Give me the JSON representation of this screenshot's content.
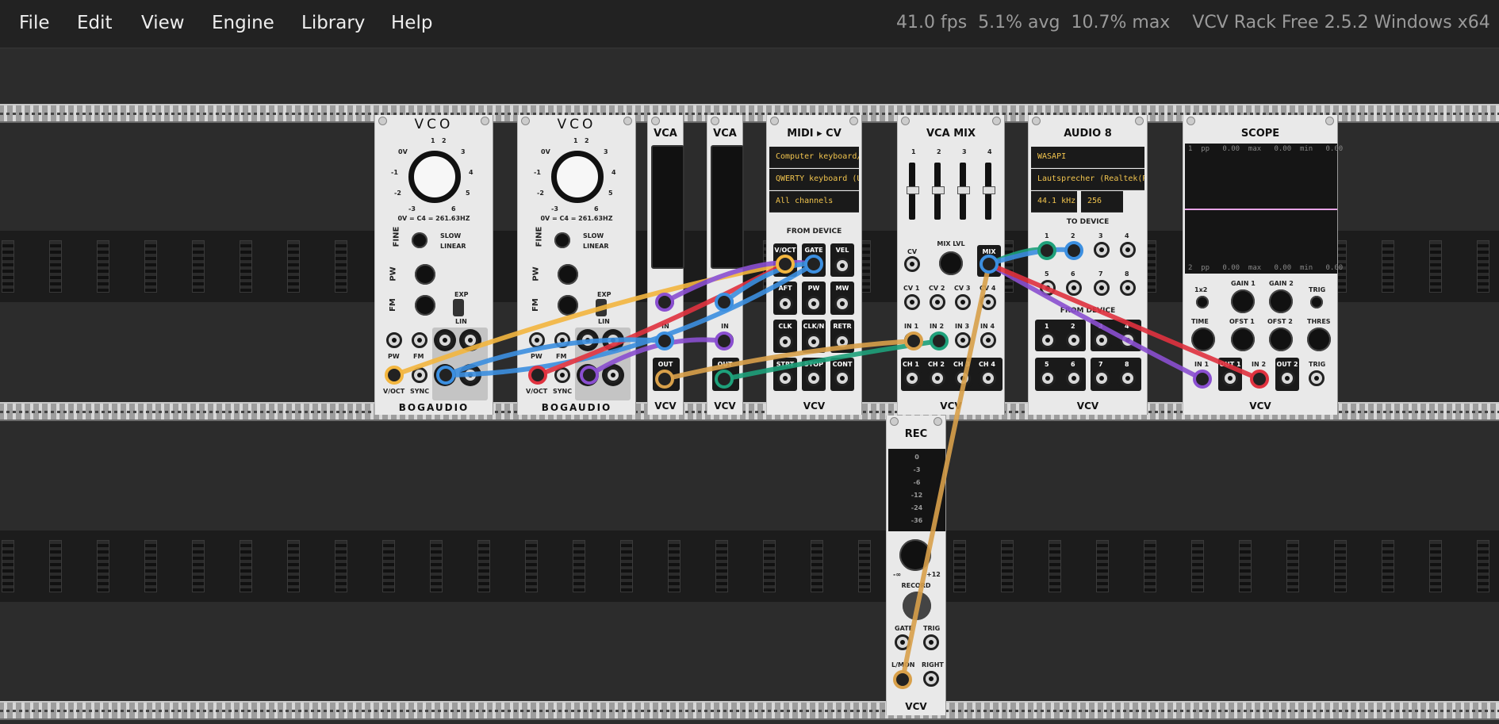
{
  "menu": {
    "file": "File",
    "edit": "Edit",
    "view": "View",
    "engine": "Engine",
    "library": "Library",
    "help": "Help"
  },
  "status": {
    "fps": "41.0 fps",
    "avg": "5.1% avg",
    "max": "10.7% max",
    "title": "VCV Rack Free 2.5.2 Windows x64"
  },
  "vco": {
    "title": "VCO",
    "scale": [
      "0V",
      "1",
      "2",
      "3",
      "4",
      "5",
      "6",
      "-3",
      "-2",
      "-1"
    ],
    "tune_caption": "0V = C4 = 261.63HZ",
    "fine": "FINE",
    "slow": "SLOW",
    "linear": "LINEAR",
    "pw": "PW",
    "fm": "FM",
    "exp": "EXP",
    "lin": "LIN",
    "jack_pw": "PW",
    "jack_fm": "FM",
    "voct": "V/OCT",
    "sync": "SYNC",
    "brand": "BOGAUDIO"
  },
  "vca": {
    "title": "VCA",
    "in": "IN",
    "out": "OUT",
    "brand": "VCV"
  },
  "midicv": {
    "title": "MIDI ▸ CV",
    "driver": "Computer keyboard/mo",
    "device": "QWERTY keyboard (US)",
    "channel": "All channels",
    "from_device": "FROM DEVICE",
    "ports": [
      "V/OCT",
      "GATE",
      "VEL",
      "AFT",
      "PW",
      "MW",
      "CLK",
      "CLK/N",
      "RETR",
      "STRT",
      "STOP",
      "CONT"
    ],
    "brand": "VCV"
  },
  "vcamix": {
    "title": "VCA MIX",
    "channels": [
      "1",
      "2",
      "3",
      "4"
    ],
    "mix_lvl": "MIX LVL",
    "cv": "CV",
    "mix": "MIX",
    "cv_labels": [
      "CV 1",
      "CV 2",
      "CV 3",
      "CV 4"
    ],
    "in_labels": [
      "IN 1",
      "IN 2",
      "IN 3",
      "IN 4"
    ],
    "ch_labels": [
      "CH 1",
      "CH 2",
      "CH 3",
      "CH 4"
    ],
    "brand": "VCV"
  },
  "audio8": {
    "title": "AUDIO 8",
    "driver": "WASAPI",
    "device": "Lautsprecher (Realtek(R) A",
    "rate": "44.1 kHz",
    "block": "256",
    "to_device": "TO DEVICE",
    "from_device": "FROM DEVICE",
    "ports_to": [
      "1",
      "2",
      "3",
      "4",
      "5",
      "6",
      "7",
      "8"
    ],
    "ports_from": [
      "1",
      "2",
      "3",
      "4",
      "5",
      "6",
      "7",
      "8"
    ],
    "brand": "VCV"
  },
  "scope": {
    "title": "SCOPE",
    "stats_top": {
      "ch": "1",
      "pp_label": "pp",
      "pp": "0.00",
      "max_label": "max",
      "max": "0.00",
      "min_label": "min",
      "min": "0.00"
    },
    "stats_bottom": {
      "ch": "2",
      "pp_label": "pp",
      "pp": "0.00",
      "max_label": "max",
      "max": "0.00",
      "min_label": "min",
      "min": "0.00"
    },
    "x2": "1x2",
    "gain1": "GAIN 1",
    "gain2": "GAIN 2",
    "trig": "TRIG",
    "time": "TIME",
    "ofst1": "OFST 1",
    "ofst2": "OFST 2",
    "thres": "THRES",
    "in1": "IN 1",
    "out1": "OUT 1",
    "in2": "IN 2",
    "out2": "OUT 2",
    "trig_jack": "TRIG",
    "brand": "VCV",
    "trace_color": "#e7a3e6"
  },
  "rec": {
    "title": "REC",
    "meter": [
      "0",
      "-3",
      "-6",
      "-12",
      "-24",
      "-36"
    ],
    "gain_min": "-∞",
    "gain_max": "+12",
    "record": "RECORD",
    "gate": "GATE",
    "trig": "TRIG",
    "lmon": "L/MON",
    "right": "RIGHT",
    "brand": "VCV"
  },
  "cable_colors": {
    "yellow": "#f3b63f",
    "blue": "#3c8fe0",
    "red": "#e0323f",
    "purple": "#8a4fd0",
    "green": "#1ea07a",
    "tan": "#d8a04a"
  }
}
